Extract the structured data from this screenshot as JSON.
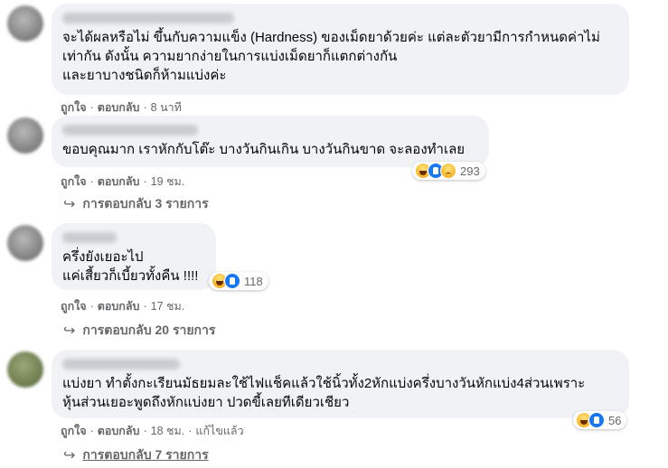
{
  "comments": [
    {
      "text": "จะได้ผลหรือไม่ ขึ้นกับความแข็ง (Hardness) ของเม็ดยาด้วยค่ะ แต่ละตัวยามีการกำหนดค่าไม่\nเท่ากัน ดังนั้น ความยากง่ายในการแบ่งเม็ดยาก็แตกต่างกัน\nและยาบางชนิดก็ห้ามแบ่งค่ะ",
      "like": "ถูกใจ",
      "reply": "ตอบกลับ",
      "time": "8 นาที"
    },
    {
      "text": "ขอบคุณมาก เราหักกับโต๊ะ บางวันกินเกิน บางวันกินขาด จะลองทำเลย",
      "like": "ถูกใจ",
      "reply": "ตอบกลับ",
      "time": "19 ชม.",
      "reactions": {
        "count": "293",
        "icons": [
          "haha-icon",
          "like-icon",
          "sad-icon"
        ]
      },
      "replies_label": "การตอบกลับ 3 รายการ"
    },
    {
      "text": "ครึ่งยังเยอะไป\nแค่เสี้ยวก็เบี้ยวทั้งคืน !!!!",
      "like": "ถูกใจ",
      "reply": "ตอบกลับ",
      "time": "17 ชม.",
      "reactions": {
        "count": "118",
        "icons": [
          "haha-icon",
          "like-icon"
        ]
      },
      "replies_label": "การตอบกลับ 20 รายการ"
    },
    {
      "text": "แบ่งยา  ทำตั้งกะเรียนมัธยมละใช้ไฟแช็คแล้วใช้นิ้วทั้ง2หักแบ่งครึ่งบางวันหักแบ่ง4ส่วนเพราะ\nหุ้นส่วนเยอะพูดถึงหักแบ่งยา  ปวดขี้เลยทีเดียวเชียว",
      "like": "ถูกใจ",
      "reply": "ตอบกลับ",
      "time": "18 ชม.",
      "edited": "แก้ไขแล้ว",
      "reactions": {
        "count": "56",
        "icons": [
          "haha-icon",
          "like-icon"
        ]
      },
      "replies_label": "การตอบกลับ 7 รายการ"
    }
  ],
  "colors": {
    "bubble": "#f0f2f5",
    "meta": "#65676b",
    "text": "#050505",
    "like": "#1877f2",
    "haha": "#f7b125"
  }
}
